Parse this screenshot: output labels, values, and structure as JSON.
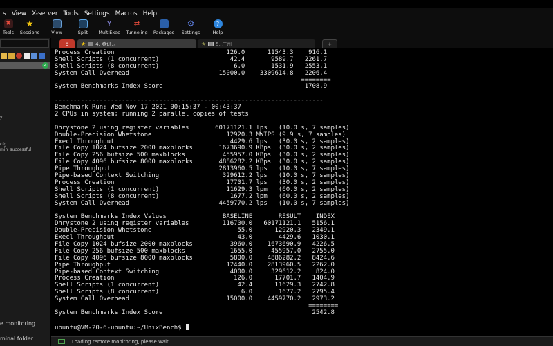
{
  "menubar": {
    "items": [
      "s",
      "View",
      "X-server",
      "Tools",
      "Settings",
      "Macros",
      "Help"
    ]
  },
  "toolbar": {
    "buttons": [
      {
        "label": "Tools",
        "icon": "tools-icon",
        "color": "#c0392b"
      },
      {
        "label": "Sessions",
        "icon": "star-icon",
        "color": "#f1c40f"
      },
      {
        "label": "View",
        "icon": "view-icon",
        "color": "#4a90d9"
      },
      {
        "label": "Split",
        "icon": "split-icon",
        "color": "#5fa8e8"
      },
      {
        "label": "MultiExec",
        "icon": "multiexec-icon",
        "color": "#8a8ae0"
      },
      {
        "label": "Tunneling",
        "icon": "tunneling-icon",
        "color": "#c0392b"
      },
      {
        "label": "Packages",
        "icon": "packages-icon",
        "color": "#3a7bd5"
      },
      {
        "label": "Settings",
        "icon": "gear-icon",
        "color": "#5a7ad8"
      },
      {
        "label": "Help",
        "icon": "help-icon",
        "color": "#2e86de"
      }
    ]
  },
  "sidebar": {
    "items": [
      "y",
      "cfg",
      "min_successful",
      "e monitoring",
      "minal folder"
    ]
  },
  "tabs": [
    {
      "label": "4. 腾讯云",
      "active": true
    },
    {
      "label": "5. 广州",
      "active": false
    },
    {
      "label": "+",
      "active": false
    }
  ],
  "terminal": {
    "lines": [
      "Process Creation                              126.0      11543.3    916.1",
      "Shell Scripts (1 concurrent)                   42.4       9589.7   2261.7",
      "Shell Scripts (8 concurrent)                    6.0       1531.9   2553.1",
      "System Call Overhead                        15000.0    3309614.8   2206.4",
      "                                                                  ========",
      "System Benchmarks Index Score                                      1708.9",
      "",
      "------------------------------------------------------------------------",
      "Benchmark Run: Wed Nov 17 2021 00:15:37 - 00:43:37",
      "2 CPUs in system; running 2 parallel copies of tests",
      "",
      "Dhrystone 2 using register variables       60171121.1 lps   (10.0 s, 7 samples)",
      "Double-Precision Whetstone                    12920.3 MWIPS (9.9 s, 7 samples)",
      "Execl Throughput                               4429.6 lps   (30.0 s, 2 samples)",
      "File Copy 1024 bufsize 2000 maxblocks       1673690.9 KBps  (30.0 s, 2 samples)",
      "File Copy 256 bufsize 500 maxblocks          455957.0 KBps  (30.0 s, 2 samples)",
      "File Copy 4096 bufsize 8000 maxblocks       4886282.2 KBps  (30.0 s, 2 samples)",
      "Pipe Throughput                             2813960.5 lps   (10.0 s, 7 samples)",
      "Pipe-based Context Switching                 329612.2 lps   (10.0 s, 7 samples)",
      "Process Creation                              17701.7 lps   (30.0 s, 2 samples)",
      "Shell Scripts (1 concurrent)                  11629.3 lpm   (60.0 s, 2 samples)",
      "Shell Scripts (8 concurrent)                   1677.2 lpm   (60.0 s, 2 samples)",
      "System Call Overhead                        4459770.2 lps   (10.0 s, 7 samples)",
      "",
      "System Benchmarks Index Values               BASELINE       RESULT    INDEX",
      "Dhrystone 2 using register variables         116700.0   60171121.1   5156.1",
      "Double-Precision Whetstone                       55.0      12920.3   2349.1",
      "Execl Throughput                                 43.0       4429.6   1030.1",
      "File Copy 1024 bufsize 2000 maxblocks          3960.0    1673690.9   4226.5",
      "File Copy 256 bufsize 500 maxblocks            1655.0     455957.0   2755.0",
      "File Copy 4096 bufsize 8000 maxblocks          5800.0    4886282.2   8424.6",
      "Pipe Throughput                               12440.0    2813960.5   2262.0",
      "Pipe-based Context Switching                   4000.0     329612.2    824.0",
      "Process Creation                                126.0      17701.7   1404.9",
      "Shell Scripts (1 concurrent)                     42.4      11629.3   2742.8",
      "Shell Scripts (8 concurrent)                      6.0       1677.2   2795.4",
      "System Call Overhead                          15000.0    4459770.2   2973.2",
      "                                                                    ========",
      "System Benchmarks Index Score                                        2542.8",
      "",
      "ubuntu@VM-20-6-ubuntu:~/UnixBench$ "
    ]
  },
  "statusbar": {
    "text": "Loading remote monitoring, please wait..."
  }
}
